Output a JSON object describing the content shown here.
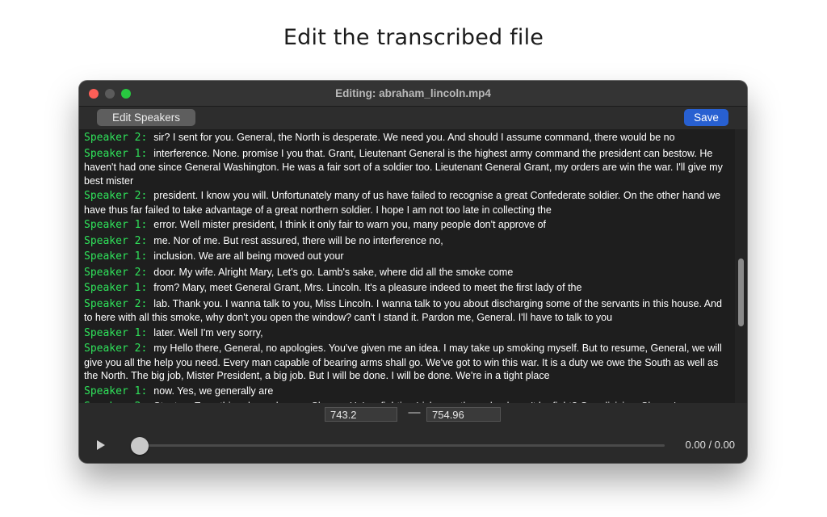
{
  "heading": "Edit the transcribed file",
  "window": {
    "title": "Editing: abraham_lincoln.mp4"
  },
  "toolbar": {
    "edit_speakers_label": "Edit Speakers",
    "save_label": "Save"
  },
  "transcript": [
    {
      "speaker": "Speaker 2:",
      "text": "sir? I sent for you. General, the North is desperate. We need you. And should I assume command, there would be no"
    },
    {
      "speaker": "Speaker 1:",
      "text": "interference. None. promise I you that. Grant, Lieutenant General is the highest army command the president can bestow. He haven't had one since General Washington. He was a fair sort of a soldier too. Lieutenant General Grant, my orders are win the war. I'll give my best mister"
    },
    {
      "speaker": "Speaker 2:",
      "text": "president. I know you will. Unfortunately many of us have failed to recognise a great Confederate soldier. On the other hand we have thus far failed to take advantage of a great northern soldier. I hope I am not too late in collecting the"
    },
    {
      "speaker": "Speaker 1:",
      "text": "error. Well mister president, I think it only fair to warn you, many people don't approve of"
    },
    {
      "speaker": "Speaker 2:",
      "text": "me. Nor of me. But rest assured, there will be no interference no,"
    },
    {
      "speaker": "Speaker 1:",
      "text": "inclusion. We are all being moved out your"
    },
    {
      "speaker": "Speaker 2:",
      "text": "door. My wife. Alright Mary, Let's go. Lamb's sake, where did all the smoke come"
    },
    {
      "speaker": "Speaker 1:",
      "text": "from? Mary, meet General Grant, Mrs. Lincoln. It's a pleasure indeed to meet the first lady of the"
    },
    {
      "speaker": "Speaker 2:",
      "text": "lab. Thank you. I wanna talk to you, Miss Lincoln. I wanna talk to you about discharging some of the servants in this house. And to here with all this smoke, why don't you open the window? can't I stand it. Pardon me, General. I'll have to talk to you"
    },
    {
      "speaker": "Speaker 1:",
      "text": "later. Well I'm very sorry,"
    },
    {
      "speaker": "Speaker 2:",
      "text": "my Hello there, General, no apologies. You've given me an idea. I may take up smoking myself. But to resume, General, we will give you all the help you need. Every man capable of bearing arms shall go. We've got to win this war. It is a duty we owe the South as well as the North. The big job, Mister President, a big job. But I will be done. I will be done. We're in a tight place"
    },
    {
      "speaker": "Speaker 1:",
      "text": "now. Yes, we generally are"
    },
    {
      "speaker": "Speaker 2:",
      "text": "Stanton. Everything depends upon Sharon. He's a fighting Irishman, then why doesn't he fight? One division, Sharon's army, routed, now trying to hold left"
    }
  ],
  "range": {
    "start": "743.2",
    "separator": "—",
    "end": "754.96"
  },
  "player": {
    "time": "0.00 / 0.00",
    "progress": 0
  },
  "colors": {
    "speaker": "#2fe25a",
    "save_button": "#2860d1",
    "background": "#1e1e1e"
  }
}
